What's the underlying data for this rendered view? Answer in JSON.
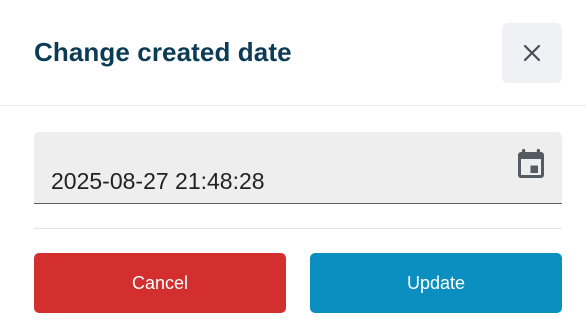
{
  "dialog": {
    "title": "Change created date",
    "close_icon": "close-icon"
  },
  "date_field": {
    "value": "2025-08-27 21:48:28",
    "icon": "calendar-icon"
  },
  "actions": {
    "cancel_label": "Cancel",
    "update_label": "Update"
  },
  "colors": {
    "title": "#0b3b55",
    "cancel": "#d32f2f",
    "update": "#0b8fc0",
    "field_bg": "#eeeeee"
  }
}
